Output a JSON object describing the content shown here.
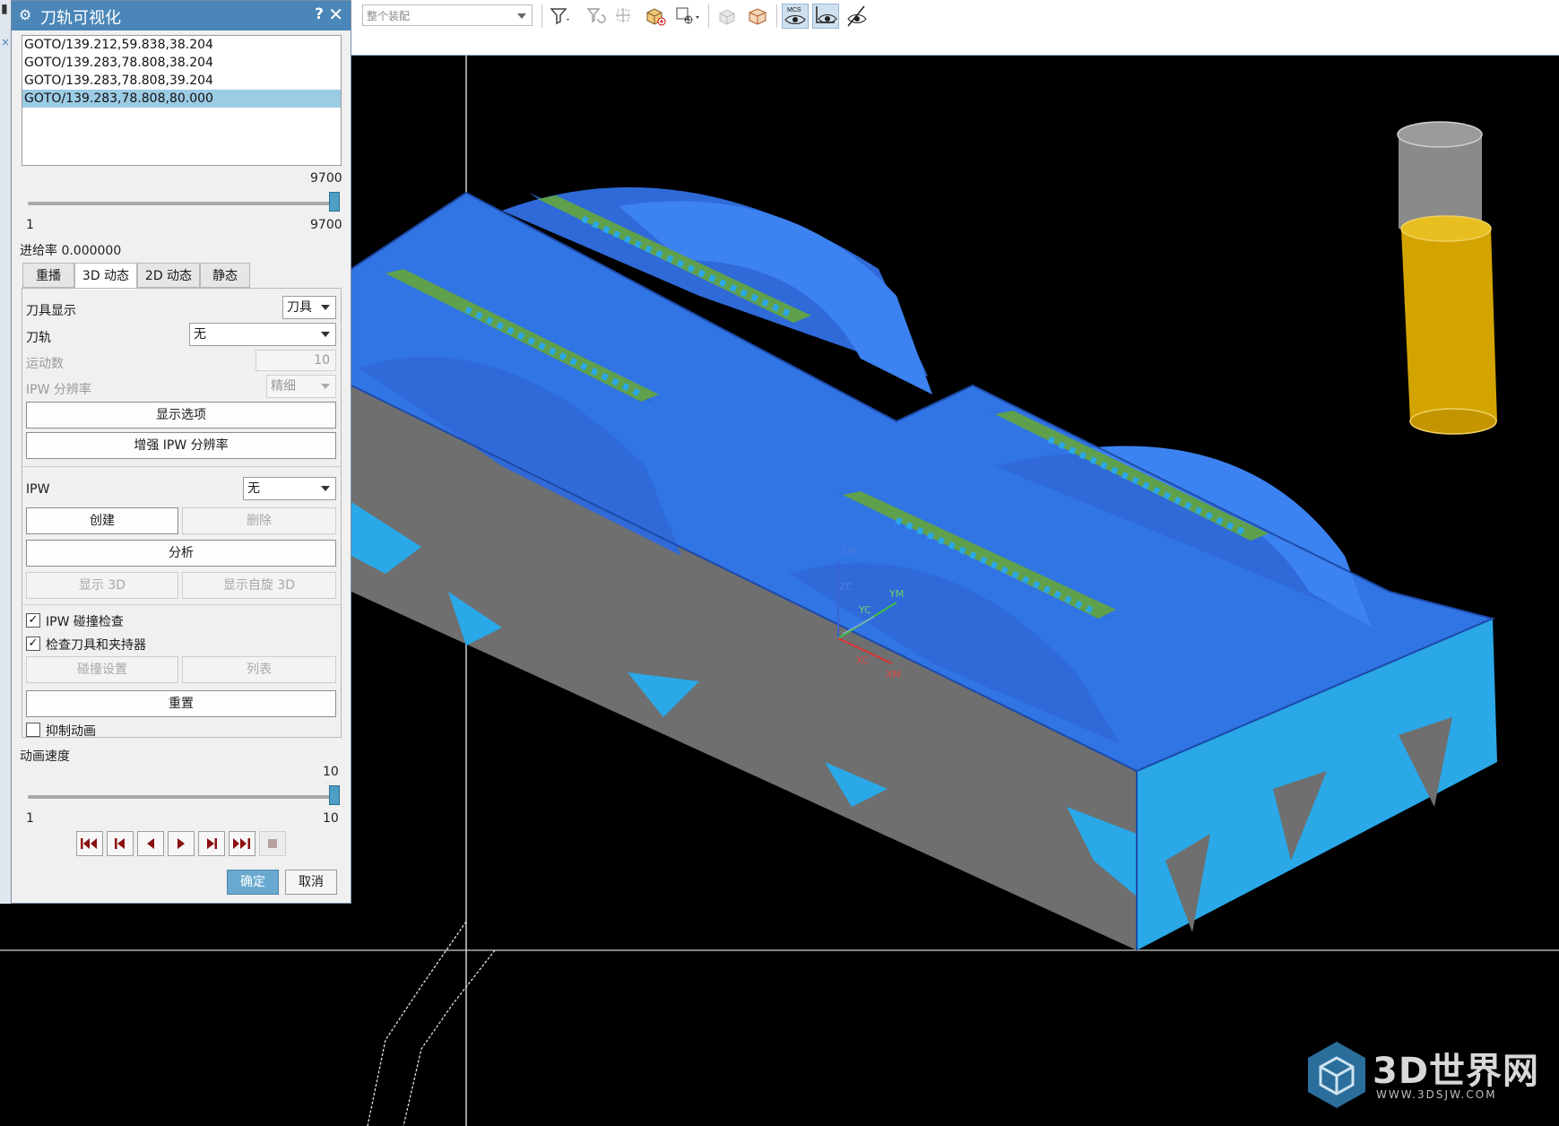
{
  "toolbar": {
    "assembly_scope": "整个装配",
    "icons": [
      "filter-icon",
      "filter-history-icon",
      "snap-point-icon",
      "box-add-icon",
      "point-add-icon",
      "wcs-icon",
      "solid-view-icon",
      "orient-view-icon",
      "mcs-visibility-icon",
      "tool-visibility-icon",
      "hide-path-icon"
    ],
    "mcs_label": "MCS"
  },
  "dialog": {
    "title": "刀轨可视化",
    "help": "?",
    "close": "✕",
    "commands": [
      "GOTO/139.212,59.838,38.204",
      "GOTO/139.283,78.808,38.204",
      "GOTO/139.283,78.808,39.204",
      "GOTO/139.283,78.808,80.000"
    ],
    "selected_command_index": 3,
    "position_slider": {
      "current_label": "9700",
      "min_label": "1",
      "max_label": "9700",
      "fraction": 1.0
    },
    "feed_rate": "进给率 0.000000",
    "tabs": [
      "重播",
      "3D 动态",
      "2D 动态",
      "静态"
    ],
    "active_tab": "3D 动态",
    "tool_display": {
      "label": "刀具显示",
      "value": "刀具"
    },
    "toolpath": {
      "label": "刀轨",
      "value": "无"
    },
    "motion_count": {
      "label": "运动数",
      "value": "10"
    },
    "ipw_resolution": {
      "label": "IPW 分辨率",
      "value": "精细"
    },
    "display_options_btn": "显示选项",
    "enhance_ipw_btn": "增强 IPW 分辨率",
    "ipw": {
      "label": "IPW",
      "value": "无"
    },
    "create_btn": "创建",
    "delete_btn": "删除",
    "analyze_btn": "分析",
    "show_3d_btn": "显示 3D",
    "show_spin_3d_btn": "显示自旋 3D",
    "ipw_collision_check": {
      "label": "IPW 碰撞检查",
      "checked": true
    },
    "check_tool_holder": {
      "label": "检查刀具和夹持器",
      "checked": true
    },
    "collision_settings_btn": "碰撞设置",
    "list_btn": "列表",
    "reset_btn": "重置",
    "suppress_animation": {
      "label": "抑制动画",
      "checked": false
    },
    "animation_speed": {
      "label": "动画速度",
      "current_label": "10",
      "min_label": "1",
      "max_label": "10",
      "fraction": 1.0
    },
    "playback": [
      "step-to-start-icon",
      "step-back-icon",
      "play-reverse-icon",
      "play-forward-icon",
      "step-forward-icon",
      "step-to-end-icon",
      "stop-icon"
    ],
    "ok_btn": "确定",
    "cancel_btn": "取消"
  },
  "viewport": {
    "axis_labels": [
      "ZM",
      "ZC",
      "YC",
      "YM",
      "XC",
      "XM"
    ],
    "colors": {
      "part": "#2f6fe0",
      "part_side": "#6e6e6e",
      "rough": "#2aa8e8",
      "finished": "#5fa04d",
      "tool_holder": "#8a8a8a",
      "tool_cutter": "#d3a400"
    }
  },
  "watermark": {
    "brand": "3D世界网",
    "url": "WWW.3DSJW.COM"
  }
}
